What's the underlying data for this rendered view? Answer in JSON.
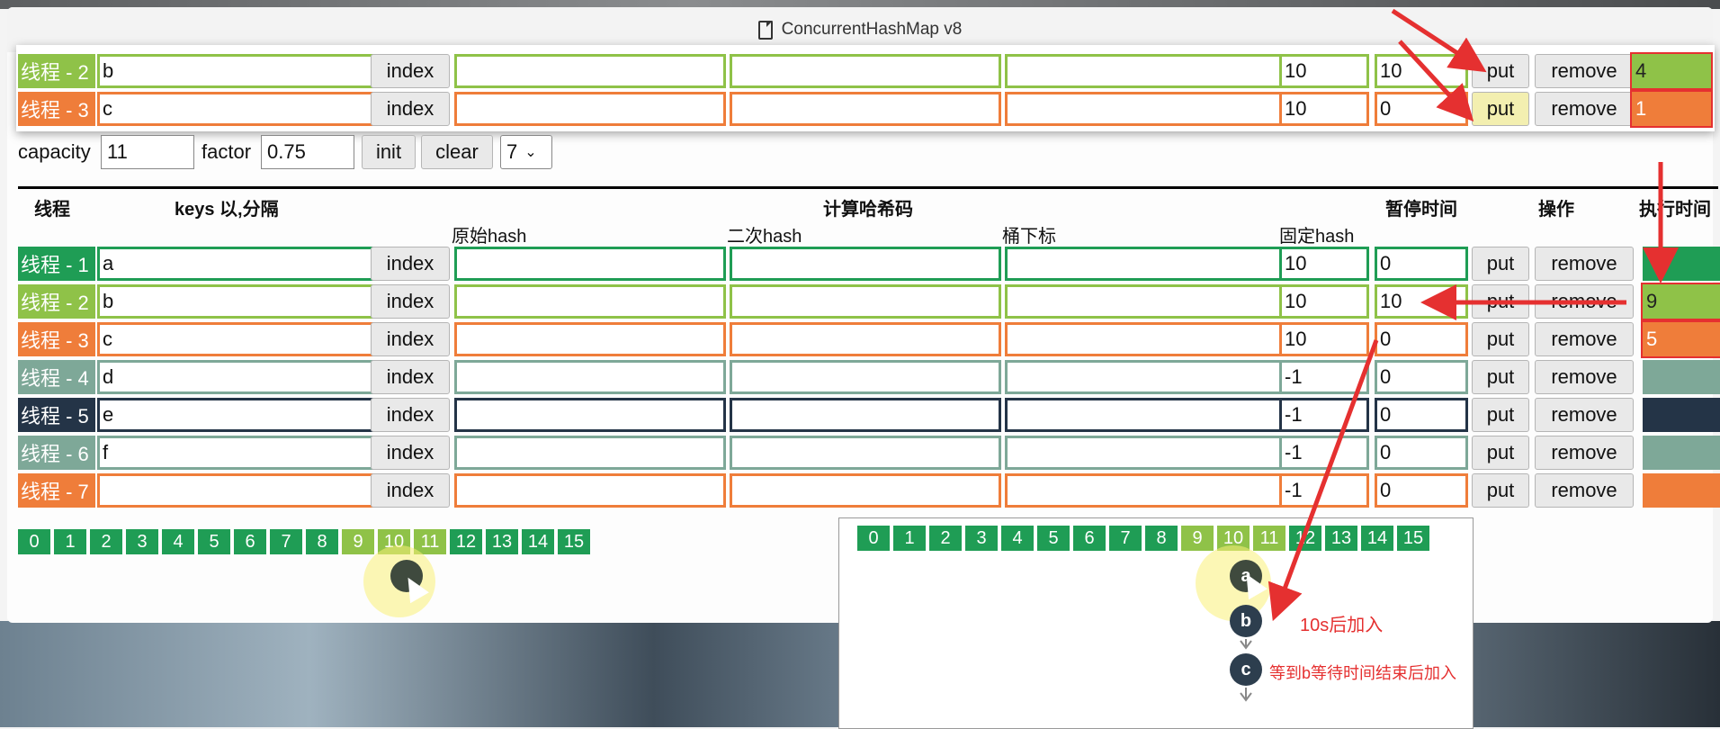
{
  "window": {
    "title": "ConcurrentHashMap v8"
  },
  "popup_rows": [
    {
      "label": "线程 - 2",
      "keys": "b",
      "index_btn": "index",
      "fixed_hash": "10",
      "pause": "10",
      "put": "put",
      "remove": "remove",
      "exec": "4"
    },
    {
      "label": "线程 - 3",
      "keys": "c",
      "index_btn": "index",
      "fixed_hash": "10",
      "pause": "0",
      "put": "put",
      "remove": "remove",
      "exec": "1"
    }
  ],
  "controls": {
    "capacity_label": "capacity",
    "capacity_value": "11",
    "factor_label": "factor",
    "factor_value": "0.75",
    "init": "init",
    "clear": "clear",
    "select_value": "7"
  },
  "headers": {
    "thread": "线程",
    "keys": "keys 以,分隔",
    "compute": "计算哈希码",
    "pause": "暂停时间",
    "op": "操作",
    "exec": "执行时间",
    "orig_hash": "原始hash",
    "second_hash": "二次hash",
    "bucket_index": "桶下标",
    "fixed_hash": "固定hash"
  },
  "rows": [
    {
      "label": "线程 - 1",
      "keys": "a",
      "index_btn": "index",
      "fixed_hash": "10",
      "pause": "0",
      "put": "put",
      "remove": "remove",
      "exec": ""
    },
    {
      "label": "线程 - 2",
      "keys": "b",
      "index_btn": "index",
      "fixed_hash": "10",
      "pause": "10",
      "put": "put",
      "remove": "remove",
      "exec": "9"
    },
    {
      "label": "线程 - 3",
      "keys": "c",
      "index_btn": "index",
      "fixed_hash": "10",
      "pause": "0",
      "put": "put",
      "remove": "remove",
      "exec": "5"
    },
    {
      "label": "线程 - 4",
      "keys": "d",
      "index_btn": "index",
      "fixed_hash": "-1",
      "pause": "0",
      "put": "put",
      "remove": "remove",
      "exec": ""
    },
    {
      "label": "线程 - 5",
      "keys": "e",
      "index_btn": "index",
      "fixed_hash": "-1",
      "pause": "0",
      "put": "put",
      "remove": "remove",
      "exec": ""
    },
    {
      "label": "线程 - 6",
      "keys": "f",
      "index_btn": "index",
      "fixed_hash": "-1",
      "pause": "0",
      "put": "put",
      "remove": "remove",
      "exec": ""
    },
    {
      "label": "线程 - 7",
      "keys": "",
      "index_btn": "index",
      "fixed_hash": "-1",
      "pause": "0",
      "put": "put",
      "remove": "remove",
      "exec": ""
    }
  ],
  "buckets": [
    "0",
    "1",
    "2",
    "3",
    "4",
    "5",
    "6",
    "7",
    "8",
    "9",
    "10",
    "11",
    "12",
    "13",
    "14",
    "15"
  ],
  "nodes": {
    "first": "a",
    "second": "b",
    "third": "c"
  },
  "annotations": {
    "note_b": "10s后加入",
    "note_c": "等到b等待时间结束后加入"
  },
  "colors": {
    "thread1": "#1f9d55",
    "thread2": "#8fc248",
    "thread3": "#ef7d3a",
    "thread4": "#7ea898",
    "thread5": "#243447",
    "arrow": "#e53030"
  }
}
